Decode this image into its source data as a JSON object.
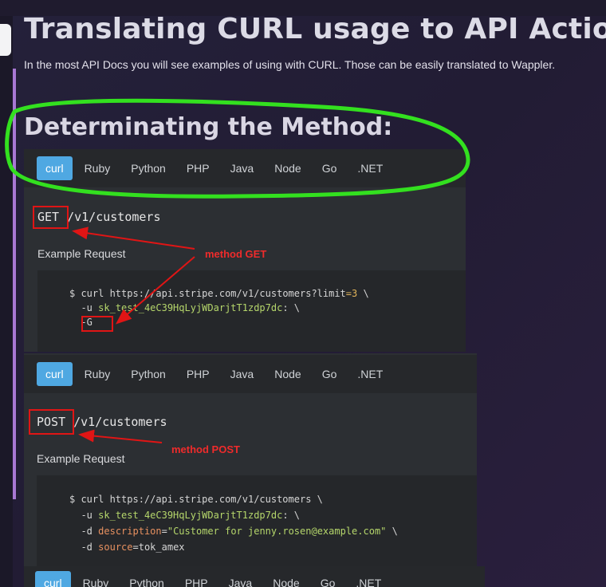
{
  "page": {
    "title": "Translating CURL usage to API Action",
    "subtitle": "In the most API Docs you will see examples of using with CURL. Those can be easily translated to Wappler."
  },
  "section": {
    "heading": "Determinating the Method:"
  },
  "tabs": [
    "curl",
    "Ruby",
    "Python",
    "PHP",
    "Java",
    "Node",
    "Go",
    ".NET"
  ],
  "get_block": {
    "method": "GET",
    "path": "/v1/customers",
    "example_label": "Example Request",
    "code": {
      "l1_prompt": "$ ",
      "l1_cmd": "curl https://api.stripe.com/v1/customers?limit",
      "l1_eq": "=",
      "l1_num": "3",
      "l1_tail": " \\",
      "l2_flag": "-u ",
      "l2_key": "sk_test_4eC39HqLyjWDarjtT1zdp7dc",
      "l2_tail": ": \\",
      "l3_flag": "-G"
    },
    "annotation": "method GET"
  },
  "post_block": {
    "method": "POST",
    "path": "/v1/customers",
    "example_label": "Example Request",
    "code": {
      "l1": "$ curl https://api.stripe.com/v1/customers \\",
      "l2_flag": "-u ",
      "l2_key": "sk_test_4eC39HqLyjWDarjtT1zdp7dc",
      "l2_tail": ": \\",
      "l3_flag": "-d ",
      "l3_param": "description",
      "l3_val": "\"Customer for jenny.rosen@example.com\"",
      "l3_tail": " \\",
      "l4_flag": "-d ",
      "l4_param": "source",
      "l4_val": "tok_amex"
    },
    "annotation": "method POST"
  },
  "colors": {
    "tab_active": "#4fa8e2",
    "annotation_red": "#e01515",
    "highlight_green": "#33e01f",
    "sidebar_accent": "#a878d4"
  }
}
